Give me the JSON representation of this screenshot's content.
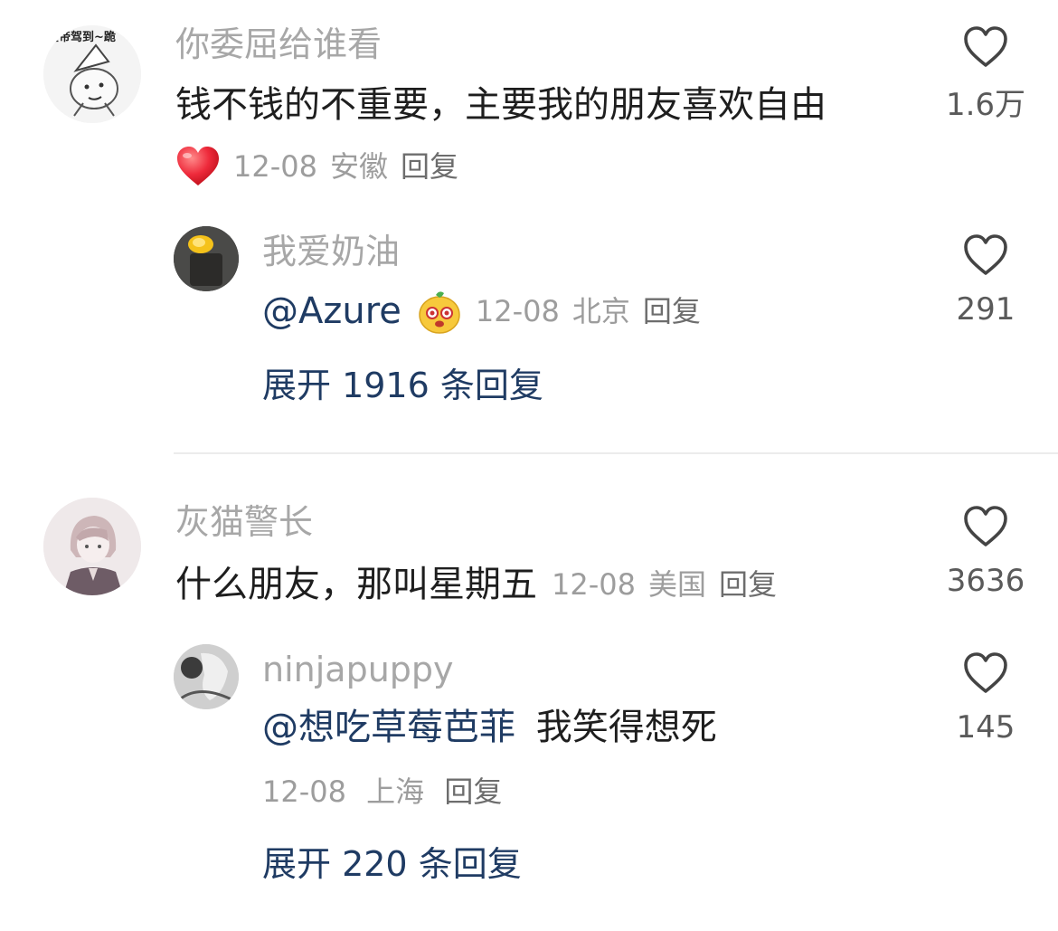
{
  "comments": [
    {
      "username": "你委屈给谁看",
      "avatar_text": "皇帝驾到~跪",
      "content": "钱不钱的不重要，主要我的朋友喜欢自由",
      "date": "12-08",
      "location": "安徽",
      "reply_label": "回复",
      "likes": "1.6万",
      "reply": {
        "username": "我爱奶油",
        "mention": "@Azure",
        "date": "12-08",
        "location": "北京",
        "reply_label": "回复",
        "likes": "291"
      },
      "expand_label": "展开 1916 条回复"
    },
    {
      "username": "灰猫警长",
      "content": "什么朋友，那叫星期五",
      "date": "12-08",
      "location": "美国",
      "reply_label": "回复",
      "likes": "3636",
      "reply": {
        "username": "ninjapuppy",
        "mention": "@想吃草莓芭菲",
        "text": "我笑得想死",
        "date": "12-08",
        "location": "上海",
        "reply_label": "回复",
        "likes": "145"
      },
      "expand_label": "展开 220 条回复"
    }
  ],
  "colors": {
    "username": "#a7a7a7",
    "content": "#1e1e1e",
    "meta": "#9d9d9d",
    "link": "#1f3b63",
    "heart_emoji": "#e8283a"
  },
  "icons": [
    "heart-outline-icon",
    "red-heart-emoji",
    "yellow-mascot-emoji"
  ]
}
